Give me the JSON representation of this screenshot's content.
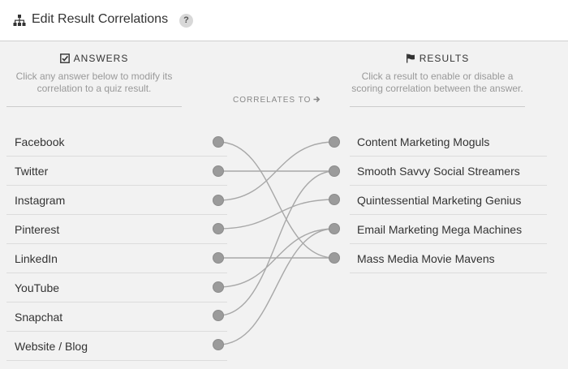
{
  "header": {
    "title": "Edit Result Correlations",
    "help": "?"
  },
  "answers": {
    "heading": "ANSWERS",
    "description": "Click any answer below to modify its correlation to a quiz result.",
    "items": [
      {
        "label": "Facebook"
      },
      {
        "label": "Twitter"
      },
      {
        "label": "Instagram"
      },
      {
        "label": "Pinterest"
      },
      {
        "label": "LinkedIn"
      },
      {
        "label": "YouTube"
      },
      {
        "label": "Snapchat"
      },
      {
        "label": "Website / Blog"
      }
    ]
  },
  "middle": {
    "correlates_label": "CORRELATES TO"
  },
  "results": {
    "heading": "RESULTS",
    "description": "Click a result to enable or disable a scoring correlation between the answer.",
    "items": [
      {
        "label": "Content Marketing Moguls"
      },
      {
        "label": "Smooth Savvy Social Streamers"
      },
      {
        "label": "Quintessential Marketing Genius"
      },
      {
        "label": "Email Marketing Mega Machines"
      },
      {
        "label": "Mass Media Movie Mavens"
      }
    ]
  },
  "correlations": [
    {
      "answer": "Facebook",
      "result": "Mass Media Movie Mavens"
    },
    {
      "answer": "Twitter",
      "result": "Smooth Savvy Social Streamers"
    },
    {
      "answer": "Instagram",
      "result": "Content Marketing Moguls"
    },
    {
      "answer": "Pinterest",
      "result": "Quintessential Marketing Genius"
    },
    {
      "answer": "LinkedIn",
      "result": "Mass Media Movie Mavens"
    },
    {
      "answer": "YouTube",
      "result": "Email Marketing Mega Machines"
    },
    {
      "answer": "Snapchat",
      "result": "Smooth Savvy Social Streamers"
    },
    {
      "answer": "Website / Blog",
      "result": "Email Marketing Mega Machines"
    }
  ],
  "colors": {
    "dot": "#9b9b9b",
    "line": "#a8a8a8",
    "background": "#f2f2f2"
  }
}
